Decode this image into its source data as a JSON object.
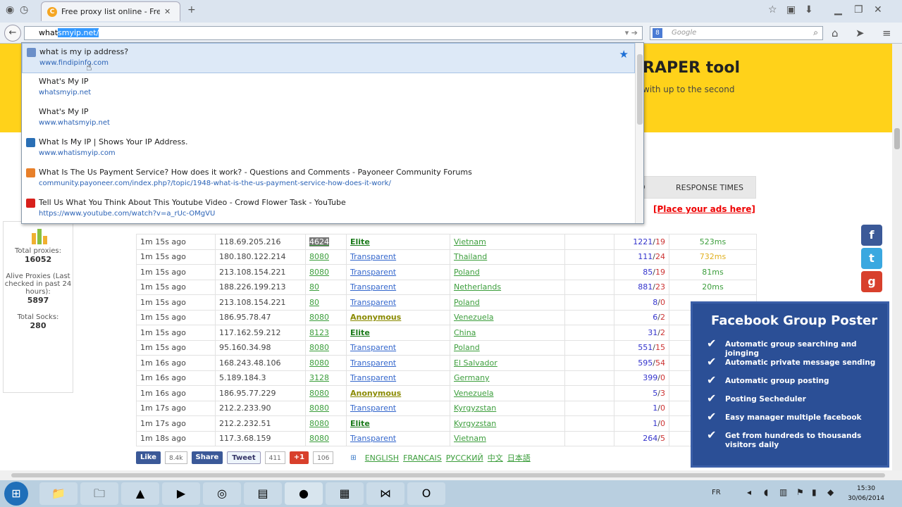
{
  "browser": {
    "tab_title": "Free proxy list online - Free...",
    "tab_favicon": "C",
    "url_typed": "what",
    "url_autocomplete": "smyip.net/",
    "search_placeholder": "Google",
    "search_engine_letter": "8"
  },
  "autocomplete": {
    "items": [
      {
        "title": "what is my ip address?",
        "url": "www.findipinfo.com",
        "icon": "page-icon",
        "selected": true
      },
      {
        "title": "What's My IP",
        "url": "whatsmyip.net"
      },
      {
        "title": "What's My IP",
        "url": "www.whatsmyip.net"
      },
      {
        "title": "What Is My IP | Shows Your IP Address.",
        "url": "www.whatismyip.com",
        "icon": "whatismyip-icon"
      },
      {
        "title": "What Is The Us Payment Service? How does it work? - Questions and Comments - Payoneer Community Forums",
        "url": "community.payoneer.com/index.php?/topic/1948-what-is-the-us-payment-service-how-does-it-work/",
        "icon": "payoneer-icon"
      },
      {
        "title": "Tell Us What You Think About This Youtube Video - Crowd Flower Task - YouTube",
        "url": "https://www.youtube.com/watch?v=a_rUc-OMgVU",
        "icon": "youtube-icon"
      }
    ]
  },
  "banner": {
    "title": "RAPER tool",
    "subtitle": "with up to the second"
  },
  "stats": {
    "total_proxies_label": "Total proxies:",
    "total_proxies": "16052",
    "alive_label": "Alive Proxies (Last checked in past 24 hours):",
    "alive": "5897",
    "socks_label": "Total Socks:",
    "socks": "280"
  },
  "table": {
    "response_header": "RESPONSE TIMES",
    "header_fragment": "D",
    "ads_text": "[Place your ads here]",
    "rows": [
      {
        "time": "1m 15s ago",
        "ip": "118.69.205.216",
        "port": "4624",
        "anon": "Elite",
        "country": "Vietnam",
        "ok": "1221",
        "fail": "19",
        "resp": "523ms",
        "hl": true
      },
      {
        "time": "1m 15s ago",
        "ip": "180.180.122.214",
        "port": "8080",
        "anon": "Transparent",
        "country": "Thailand",
        "ok": "111",
        "fail": "24",
        "resp": "732ms"
      },
      {
        "time": "1m 15s ago",
        "ip": "213.108.154.221",
        "port": "8080",
        "anon": "Transparent",
        "country": "Poland",
        "ok": "85",
        "fail": "19",
        "resp": "81ms"
      },
      {
        "time": "1m 15s ago",
        "ip": "188.226.199.213",
        "port": "80",
        "anon": "Transparent",
        "country": "Netherlands",
        "ok": "881",
        "fail": "23",
        "resp": "20ms"
      },
      {
        "time": "1m 15s ago",
        "ip": "213.108.154.221",
        "port": "80",
        "anon": "Transparent",
        "country": "Poland",
        "ok": "8",
        "fail": "0",
        "resp": ""
      },
      {
        "time": "1m 15s ago",
        "ip": "186.95.78.47",
        "port": "8080",
        "anon": "Anonymous",
        "country": "Venezuela",
        "ok": "6",
        "fail": "2",
        "resp": ""
      },
      {
        "time": "1m 15s ago",
        "ip": "117.162.59.212",
        "port": "8123",
        "anon": "Elite",
        "country": "China",
        "ok": "31",
        "fail": "2",
        "resp": ""
      },
      {
        "time": "1m 15s ago",
        "ip": "95.160.34.98",
        "port": "8080",
        "anon": "Transparent",
        "country": "Poland",
        "ok": "551",
        "fail": "15",
        "resp": ""
      },
      {
        "time": "1m 16s ago",
        "ip": "168.243.48.106",
        "port": "8080",
        "anon": "Transparent",
        "country": "El Salvador",
        "ok": "595",
        "fail": "54",
        "resp": ""
      },
      {
        "time": "1m 16s ago",
        "ip": "5.189.184.3",
        "port": "3128",
        "anon": "Transparent",
        "country": "Germany",
        "ok": "399",
        "fail": "0",
        "resp": ""
      },
      {
        "time": "1m 16s ago",
        "ip": "186.95.77.229",
        "port": "8080",
        "anon": "Anonymous",
        "country": "Venezuela",
        "ok": "5",
        "fail": "3",
        "resp": ""
      },
      {
        "time": "1m 17s ago",
        "ip": "212.2.233.90",
        "port": "8080",
        "anon": "Transparent",
        "country": "Kyrgyzstan",
        "ok": "1",
        "fail": "0",
        "resp": ""
      },
      {
        "time": "1m 17s ago",
        "ip": "212.2.232.51",
        "port": "8080",
        "anon": "Elite",
        "country": "Kyrgyzstan",
        "ok": "1",
        "fail": "0",
        "resp": ""
      },
      {
        "time": "1m 18s ago",
        "ip": "117.3.68.159",
        "port": "8080",
        "anon": "Transparent",
        "country": "Vietnam",
        "ok": "264",
        "fail": "5",
        "resp": ""
      }
    ]
  },
  "fb_panel": {
    "title": "Facebook Group Poster",
    "features": [
      "Automatic group searching and joinging",
      "Automatic private message sending",
      "Automatic group posting",
      "Posting Secheduler",
      "Easy manager multiple facebook",
      "Get from hundreds to thousands visitors daily"
    ]
  },
  "share": {
    "like_label": "Like",
    "like_count": "8.4k",
    "share_label": "Share",
    "tweet_label": "Tweet",
    "tweet_count": "411",
    "gplus_label": "+1",
    "gplus_count": "106",
    "languages": [
      "ENGLISH",
      "FRANCAIS",
      "РУССКИЙ",
      "中文",
      "日本語"
    ]
  },
  "taskbar": {
    "lang": "FR",
    "time": "15:30",
    "date": "30/06/2014"
  },
  "colors": {
    "banner": "#ffd21a",
    "fb_panel": "#2b4f96",
    "link_green": "#3c9e3c",
    "ads_red": "#ee0000"
  }
}
